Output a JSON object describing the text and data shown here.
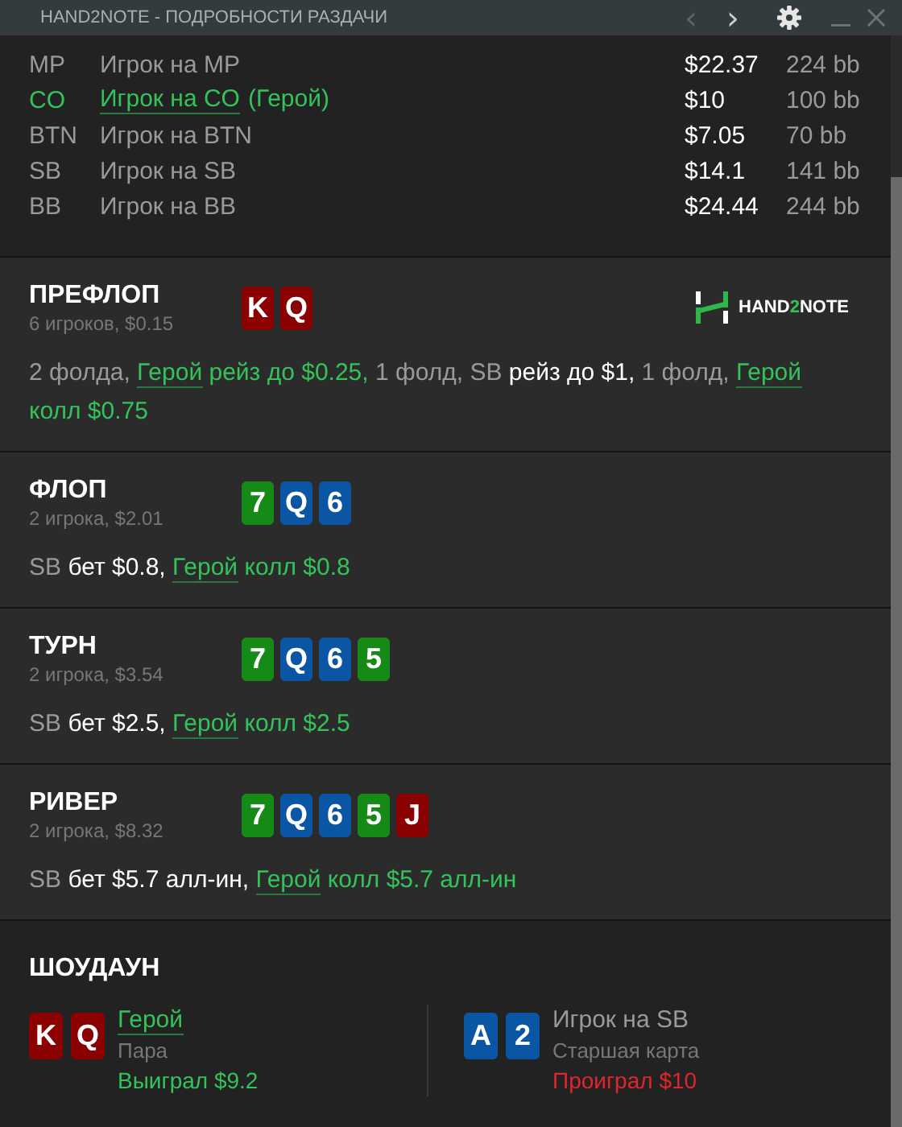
{
  "window": {
    "title": "HAND2NOTE - ПОДРОБНОСТИ РАЗДАЧИ",
    "nav": [
      {
        "glyph": "‹",
        "disabled": true
      },
      {
        "glyph": "›",
        "disabled": false
      }
    ]
  },
  "players": [
    {
      "position": "MP",
      "name": "Игрок на MP",
      "hero": false,
      "stack": "$22.37",
      "bb": "224 bb"
    },
    {
      "position": "CO",
      "name": "Игрок на CO",
      "hero_tag": "(Герой)",
      "hero": true,
      "stack": "$10",
      "bb": "100 bb"
    },
    {
      "position": "BTN",
      "name": "Игрок на BTN",
      "hero": false,
      "stack": "$7.05",
      "bb": "70 bb"
    },
    {
      "position": "SB",
      "name": "Игрок на SB",
      "hero": false,
      "stack": "$14.1",
      "bb": "141 bb"
    },
    {
      "position": "BB",
      "name": "Игрок на BB",
      "hero": false,
      "stack": "$24.44",
      "bb": "244 bb"
    }
  ],
  "streets": [
    {
      "title": "ПРЕФЛОП",
      "info": "6 игроков, $0.15",
      "cards": [
        {
          "rank": "K",
          "color": "#8b0000"
        },
        {
          "rank": "Q",
          "color": "#8b0000"
        }
      ],
      "logo": [
        {
          "text": "HAND",
          "accent": false
        },
        {
          "text": "2",
          "accent": true
        },
        {
          "text": "NOTE",
          "accent": false
        }
      ],
      "actions": [
        {
          "text": "2 фолда, ",
          "kind": "muted"
        },
        {
          "text": "Герой",
          "kind": "hero-link"
        },
        {
          "text": " рейз до $0.25,",
          "kind": "hero"
        },
        {
          "text": " 1 фолд, SB ",
          "kind": "muted"
        },
        {
          "text": "рейз до $1,",
          "kind": "white"
        },
        {
          "text": " 1 фолд, ",
          "kind": "muted"
        },
        {
          "text": "Герой",
          "kind": "hero-link"
        },
        {
          "text": " колл $0.75",
          "kind": "hero"
        }
      ]
    },
    {
      "title": "ФЛОП",
      "info": "2 игрока, $2.01",
      "cards": [
        {
          "rank": "7",
          "color": "#168a16"
        },
        {
          "rank": "Q",
          "color": "#0b56a4"
        },
        {
          "rank": "6",
          "color": "#0b56a4"
        }
      ],
      "actions": [
        {
          "text": "SB ",
          "kind": "muted"
        },
        {
          "text": "бет $0.8, ",
          "kind": "white"
        },
        {
          "text": "Герой",
          "kind": "hero-link"
        },
        {
          "text": " колл $0.8",
          "kind": "hero"
        }
      ]
    },
    {
      "title": "ТУРН",
      "info": "2 игрока, $3.54",
      "cards": [
        {
          "rank": "7",
          "color": "#168a16"
        },
        {
          "rank": "Q",
          "color": "#0b56a4"
        },
        {
          "rank": "6",
          "color": "#0b56a4"
        },
        {
          "rank": "5",
          "color": "#168a16"
        }
      ],
      "actions": [
        {
          "text": "SB ",
          "kind": "muted"
        },
        {
          "text": "бет $2.5, ",
          "kind": "white"
        },
        {
          "text": "Герой",
          "kind": "hero-link"
        },
        {
          "text": " колл $2.5",
          "kind": "hero"
        }
      ]
    },
    {
      "title": "РИВЕР",
      "info": "2 игрока, $8.32",
      "cards": [
        {
          "rank": "7",
          "color": "#168a16"
        },
        {
          "rank": "Q",
          "color": "#0b56a4"
        },
        {
          "rank": "6",
          "color": "#0b56a4"
        },
        {
          "rank": "5",
          "color": "#168a16"
        },
        {
          "rank": "J",
          "color": "#8b0000"
        }
      ],
      "actions": [
        {
          "text": "SB ",
          "kind": "muted"
        },
        {
          "text": "бет $5.7 алл-ин, ",
          "kind": "white"
        },
        {
          "text": "Герой",
          "kind": "hero-link"
        },
        {
          "text": " колл $5.7 алл-ин",
          "kind": "hero"
        }
      ]
    }
  ],
  "showdown": {
    "title": "ШОУДАУН",
    "hands": [
      {
        "cards": [
          {
            "rank": "K",
            "color": "#8b0000"
          },
          {
            "rank": "Q",
            "color": "#8b0000"
          }
        ],
        "name": "Герой",
        "hero": true,
        "hand": "Пара",
        "result": "Выиграл $9.2",
        "won": true
      },
      {
        "cards": [
          {
            "rank": "A",
            "color": "#0b56a4"
          },
          {
            "rank": "2",
            "color": "#0b56a4"
          }
        ],
        "name": "Игрок на SB",
        "hero": false,
        "hand": "Старшая карта",
        "result": "Проиграл $10",
        "won": false
      }
    ]
  }
}
